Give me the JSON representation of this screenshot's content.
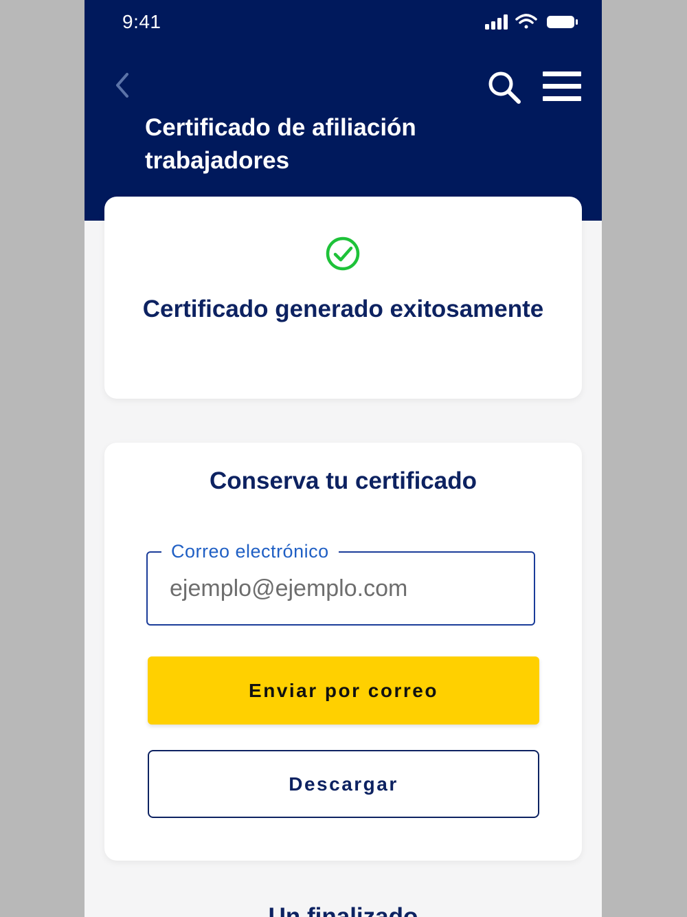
{
  "status_bar": {
    "time": "9:41"
  },
  "header": {
    "title": "Certificado de afiliación trabajadores",
    "back_icon": "chevron-left-icon",
    "search_icon": "search-icon",
    "menu_icon": "hamburger-menu-icon"
  },
  "success_card": {
    "icon": "check-circle-icon",
    "message": "Certificado generado exitosamente"
  },
  "keep_card": {
    "title": "Conserva tu certificado",
    "email_label": "Correo electrónico",
    "email_placeholder": "ejemplo@ejemplo.com",
    "send_label": "Enviar por correo",
    "download_label": "Descargar"
  },
  "next_section": {
    "title": "Un finalizado"
  },
  "colors": {
    "header_bg": "#00195c",
    "primary_text": "#0d2261",
    "accent_yellow": "#ffd000",
    "success_green": "#1ec239",
    "link_blue": "#1f5fc4"
  }
}
